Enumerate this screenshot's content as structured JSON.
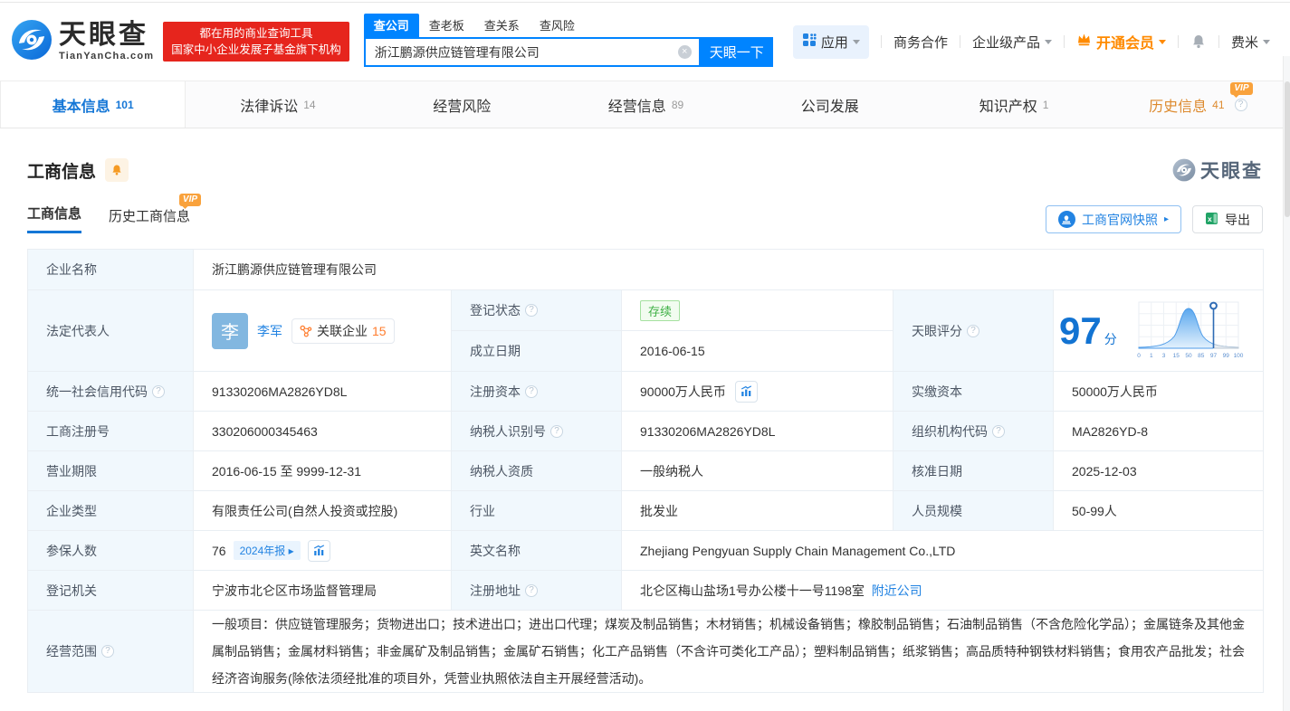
{
  "colors": {
    "accent": "#0084ff",
    "brand_red": "#e6251d",
    "vip_orange": "#ff8a00",
    "status_green": "#3eb045",
    "link_blue": "#2283e2",
    "score_blue": "#1273d2"
  },
  "header": {
    "brand": {
      "cn": "天眼查",
      "en": "TianYanCha.com",
      "slogan1": "都在用的商业查询工具",
      "slogan2": "国家中小企业发展子基金旗下机构"
    },
    "search": {
      "tabs": [
        "查公司",
        "查老板",
        "查关系",
        "查风险"
      ],
      "value": "浙江鹏源供应链管理有限公司",
      "button": "天眼一下"
    },
    "nav": {
      "apps": "应用",
      "coop": "商务合作",
      "enterprise": "企业级产品",
      "vip": "开通会员",
      "user": "费米"
    }
  },
  "tabs": [
    {
      "label": "基本信息",
      "count": "101"
    },
    {
      "label": "法律诉讼",
      "count": "14"
    },
    {
      "label": "经营风险",
      "count": ""
    },
    {
      "label": "经营信息",
      "count": "89"
    },
    {
      "label": "公司发展",
      "count": ""
    },
    {
      "label": "知识产权",
      "count": "1"
    },
    {
      "label": "历史信息",
      "count": "41",
      "vip": "VIP"
    }
  ],
  "section": {
    "title": "工商信息",
    "subtab_current": "工商信息",
    "subtab_history": "历史工商信息",
    "vip": "VIP",
    "snapshot": "工商官网快照",
    "export": "导出",
    "watermark": "天眼查"
  },
  "fields": {
    "name_label": "企业名称",
    "name": "浙江鹏源供应链管理有限公司",
    "legal_label": "法定代表人",
    "legal_avatar": "李",
    "legal_name": "李军",
    "related_label": "关联企业",
    "related_count": "15",
    "status_label": "登记状态",
    "status": "存续",
    "established_label": "成立日期",
    "established": "2016-06-15",
    "score_label": "天眼评分",
    "credit_label": "统一社会信用代码",
    "credit": "91330206MA2826YD8L",
    "regcap_label": "注册资本",
    "regcap": "90000万人民币",
    "paidcap_label": "实缴资本",
    "paidcap": "50000万人民币",
    "regno_label": "工商注册号",
    "regno": "330206000345463",
    "taxid_label": "纳税人识别号",
    "taxid": "91330206MA2826YD8L",
    "orgcode_label": "组织机构代码",
    "orgcode": "MA2826YD-8",
    "term_label": "营业期限",
    "term": "2016-06-15 至 9999-12-31",
    "taxquality_label": "纳税人资质",
    "taxquality": "一般纳税人",
    "approval_label": "核准日期",
    "approval": "2025-12-03",
    "type_label": "企业类型",
    "type": "有限责任公司(自然人投资或控股)",
    "industry_label": "行业",
    "industry": "批发业",
    "staff_label": "人员规模",
    "staff": "50-99人",
    "insured_label": "参保人数",
    "insured": "76",
    "annual_report": "2024年报",
    "enname_label": "英文名称",
    "enname": "Zhejiang Pengyuan Supply Chain Management Co.,LTD",
    "authority_label": "登记机关",
    "authority": "宁波市北仑区市场监督管理局",
    "address_label": "注册地址",
    "address": "北仑区梅山盐场1号办公楼十一号1198室",
    "nearby": "附近公司",
    "scope_label": "经营范围",
    "scope": "一般项目：供应链管理服务；货物进出口；技术进出口；进出口代理；煤炭及制品销售；木材销售；机械设备销售；橡胶制品销售；石油制品销售（不含危险化学品）；金属链条及其他金属制品销售；金属材料销售；非金属矿及制品销售；金属矿石销售；化工产品销售（不含许可类化工产品）；塑料制品销售；纸浆销售；高品质特种钢铁材料销售；食用农产品批发；社会经济咨询服务(除依法须经批准的项目外，凭营业执照依法自主开展经营活动)。"
  },
  "score_chart": {
    "type": "area",
    "value": "97",
    "unit": "分",
    "ticks": [
      "0",
      "1",
      "3",
      "15",
      "50",
      "85",
      "97",
      "99",
      "100"
    ],
    "marker_tick": "97",
    "description": "score distribution bell curve with marker at 97"
  }
}
